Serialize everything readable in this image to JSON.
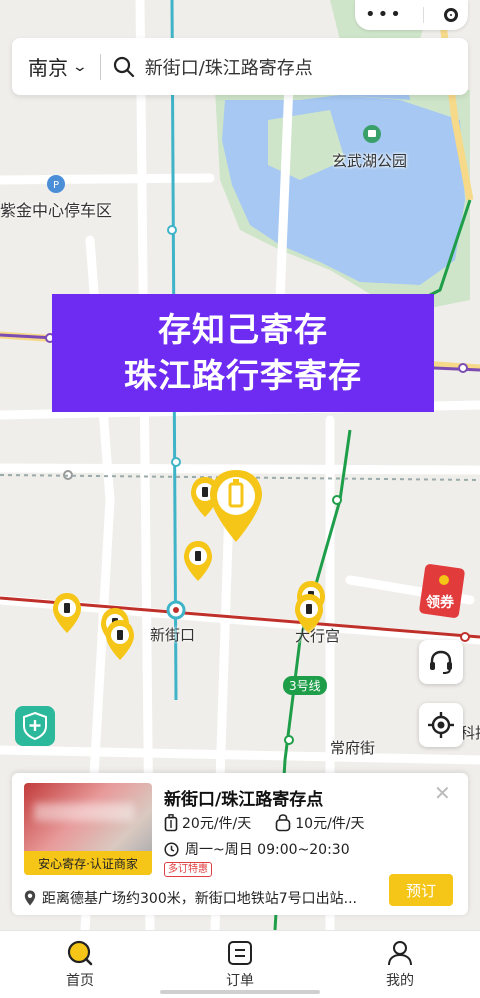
{
  "capsule": {
    "more_icon": "more-dots-icon",
    "close_icon": "mini-program-close-icon"
  },
  "search": {
    "city": "南京",
    "query": "新街口/珠江路寄存点"
  },
  "banner": {
    "line1": "存知己寄存",
    "line2": "珠江路行李寄存"
  },
  "map": {
    "labels": {
      "park": "玄武湖公园",
      "parking": "紫金中心停车区",
      "station1": "新街口",
      "station2": "大行宫",
      "road": "常府街",
      "line": "3号线",
      "edge": "科技"
    }
  },
  "floating": {
    "coupon": "领券"
  },
  "card": {
    "title": "新街口/珠江路寄存点",
    "tag": "安心寄存·认证商家",
    "price_large": "20元/件/天",
    "price_small": "10元/件/天",
    "hours": "周一~周日 09:00~20:30",
    "badge": "多订特惠",
    "address": "距离德基广场约300米，新街口地铁站7号口出站...",
    "book_label": "预订"
  },
  "tabs": [
    {
      "label": "首页",
      "icon": "search-home-icon",
      "active": true
    },
    {
      "label": "订单",
      "icon": "order-icon",
      "active": false
    },
    {
      "label": "我的",
      "icon": "profile-icon",
      "active": false
    }
  ],
  "colors": {
    "accent": "#f5c518",
    "banner": "#6e2cf2",
    "metro_line2": "#c0302a",
    "metro_line3": "#1f9e4a",
    "water": "#a6c8f2"
  }
}
